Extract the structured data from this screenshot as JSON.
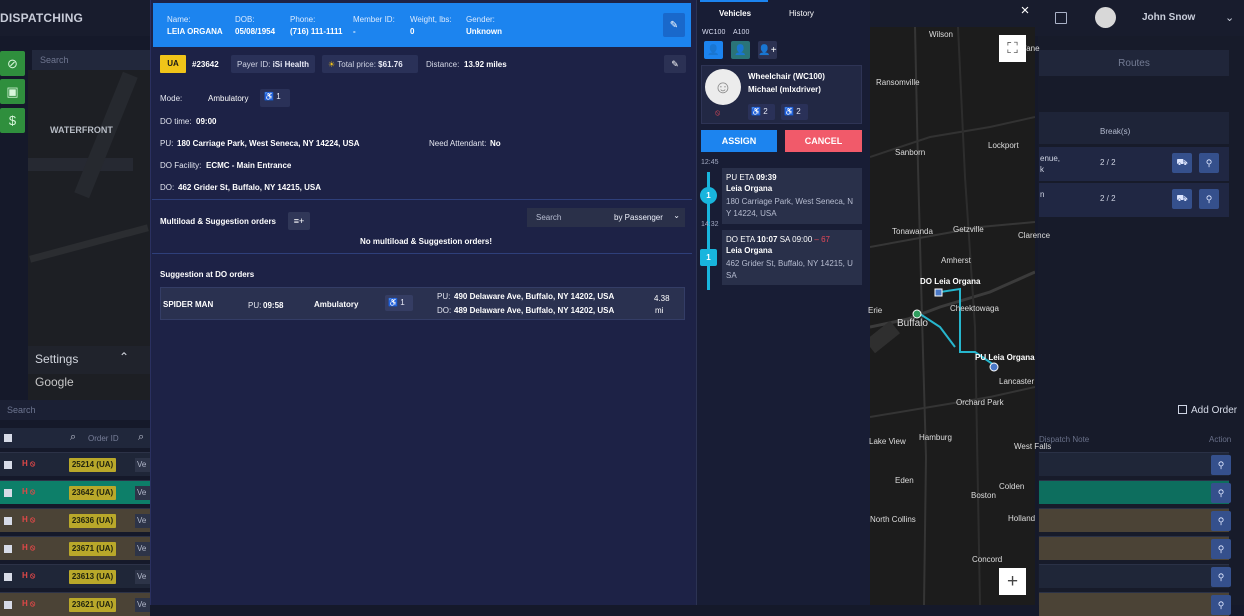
{
  "app": {
    "title": "DISPATCHING",
    "user_name": "John Snow"
  },
  "background": {
    "search_placeholder": "Search",
    "map_text": "WATERFRONT",
    "map_settings": "Settings",
    "map_brand": "Google",
    "orders": {
      "search_placeholder": "Search",
      "order_id_label": "Order ID",
      "rows": [
        {
          "id": "25214 (UA)",
          "status": "H ⦸",
          "more": "Ve",
          "color": "#1f2638"
        },
        {
          "id": "23642 (UA)",
          "status": "H ⦸",
          "more": "Ve",
          "color": "#0d7f69"
        },
        {
          "id": "23636 (UA)",
          "status": "H ⦸",
          "more": "Ve",
          "color": "#4b4336"
        },
        {
          "id": "23671 (UA)",
          "status": "H ⦸",
          "more": "Ve",
          "color": "#4b4336"
        },
        {
          "id": "23613 (UA)",
          "status": "H ⦸",
          "more": "Ve",
          "color": "#1f2638"
        },
        {
          "id": "23621 (UA)",
          "status": "H ⦸",
          "more": "Ve",
          "color": "#4b4336"
        }
      ]
    },
    "right": {
      "routes_tab": "Routes",
      "breaks_header": "Break(s)",
      "rows": [
        {
          "fragment": "enue,\nk",
          "breaks": "2 / 2"
        },
        {
          "fragment": "n",
          "breaks": "2 / 2"
        }
      ],
      "add_order": "Add Order",
      "dispatch_note": "Dispatch Note",
      "action": "Action"
    }
  },
  "order": {
    "patient": {
      "name_label": "Name:",
      "name": "LEIA ORGANA",
      "dob_label": "DOB:",
      "dob": "05/08/1954",
      "phone_label": "Phone:",
      "phone": "(716) 111-1111",
      "member_label": "Member ID:",
      "member": "-",
      "weight_label": "Weight, lbs:",
      "weight": "0",
      "gender_label": "Gender:",
      "gender": "Unknown"
    },
    "ua_badge": "UA",
    "order_number": "#23642",
    "payer_label": "Payer ID:",
    "payer": "iSi Health",
    "total_label": "Total price:",
    "total": "$61.76",
    "distance_label": "Distance:",
    "distance": "13.92 miles",
    "mode_label": "Mode:",
    "mode": "Ambulatory",
    "mode_count": "1",
    "do_time_label": "DO time:",
    "do_time": "09:00",
    "pu_label": "PU:",
    "pu": "180 Carriage Park, West Seneca, NY 14224, USA",
    "attendant_label": "Need Attendant:",
    "attendant": "No",
    "do_facility_label": "DO Facility:",
    "do_facility": "ECMC - Main Entrance",
    "do_label": "DO:",
    "do": "462 Grider St, Buffalo, NY 14215, USA",
    "multiload_title": "Multiload & Suggestion orders",
    "search_placeholder": "Search",
    "filter": "by Passenger",
    "no_multiload": "No multiload & Suggestion orders!",
    "suggestion_title": "Suggestion at DO orders",
    "suggestion": {
      "name": "SPIDER MAN",
      "pu_time_label": "PU:",
      "pu_time": "09:58",
      "mode": "Ambulatory",
      "count": "1",
      "pu_address_label": "PU:",
      "pu_address": "490 Delaware Ave, Buffalo, NY 14202, USA",
      "do_address_label": "DO:",
      "do_address": "489 Delaware Ave, Buffalo, NY 14202, USA",
      "distance": "4.38",
      "distance_unit": "mi"
    }
  },
  "assign": {
    "tab_vehicles": "Vehicles",
    "tab_history": "History",
    "mini_tab_1": "WC100",
    "mini_tab_2": "A100",
    "vehicle_line": "Wheelchair (WC100)",
    "driver_line": "Michael (mlxdriver)",
    "capacity_1": "2",
    "capacity_2": "2",
    "assign_label": "ASSIGN",
    "cancel_label": "CANCEL",
    "stops": [
      {
        "time": "12:45",
        "marker": "1",
        "title": "PU ETA",
        "eta": "09:39",
        "name": "Leia Organa",
        "address": "180 Carriage Park, West Seneca, N Y 14224, USA",
        "sa": "",
        "late": ""
      },
      {
        "time": "14:32",
        "marker": "1",
        "title": "DO ETA",
        "eta": "10:07",
        "name": "Leia Organa",
        "address": "462 Grider St, Buffalo, NY 14215, U SA",
        "sa": "SA 09:00",
        "late": "– 67"
      }
    ]
  },
  "map": {
    "close_label": "×",
    "labels": [
      "Wilson",
      "Ransomville",
      "Sanborn",
      "Lockport",
      "Tonawanda",
      "Getzville",
      "Clarence",
      "Amherst",
      "DO Leia Organa",
      "Cheektowaga",
      "Buffalo",
      "PU Leia Organa",
      "Orchard Park",
      "West Falls",
      "Lake View",
      "Hamburg",
      "Eden",
      "Colden",
      "Boston",
      "North Collins",
      "Concord",
      "Erie",
      "Newfane",
      "Holland",
      "Lancaster"
    ]
  }
}
